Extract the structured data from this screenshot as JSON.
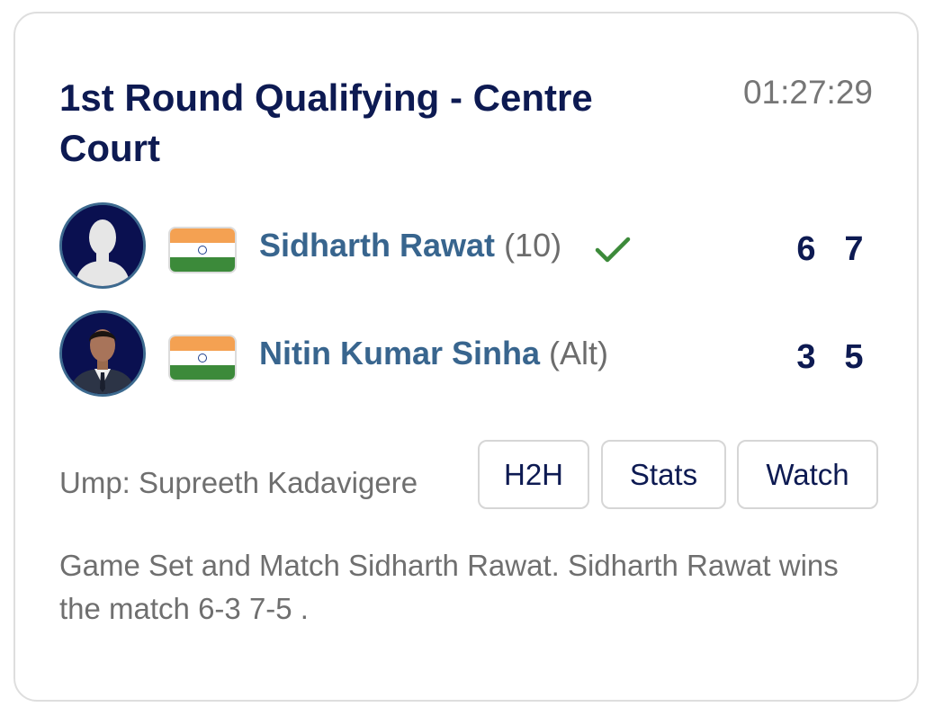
{
  "match": {
    "title": "1st Round Qualifying - Centre Court",
    "duration": "01:27:29"
  },
  "players": [
    {
      "name": "Sidharth Rawat",
      "seed": "(10)",
      "country_flag": "india-flag",
      "winner": true,
      "sets": [
        "6",
        "7"
      ]
    },
    {
      "name": "Nitin Kumar Sinha",
      "seed": "(Alt)",
      "country_flag": "india-flag",
      "winner": false,
      "sets": [
        "3",
        "5"
      ]
    }
  ],
  "umpire": "Ump: Supreeth Kadavigere",
  "actions": {
    "h2h_label": "H2H",
    "stats_label": "Stats",
    "watch_label": "Watch"
  },
  "summary": "Game Set and Match Sidharth Rawat. Sidharth Rawat wins the match 6-3 7-5 .",
  "colors": {
    "title": "#0d1a52",
    "player_name": "#38658e",
    "muted_text": "#6f6f6f",
    "winner_check": "#3c8a3a",
    "card_border": "#dedede"
  }
}
